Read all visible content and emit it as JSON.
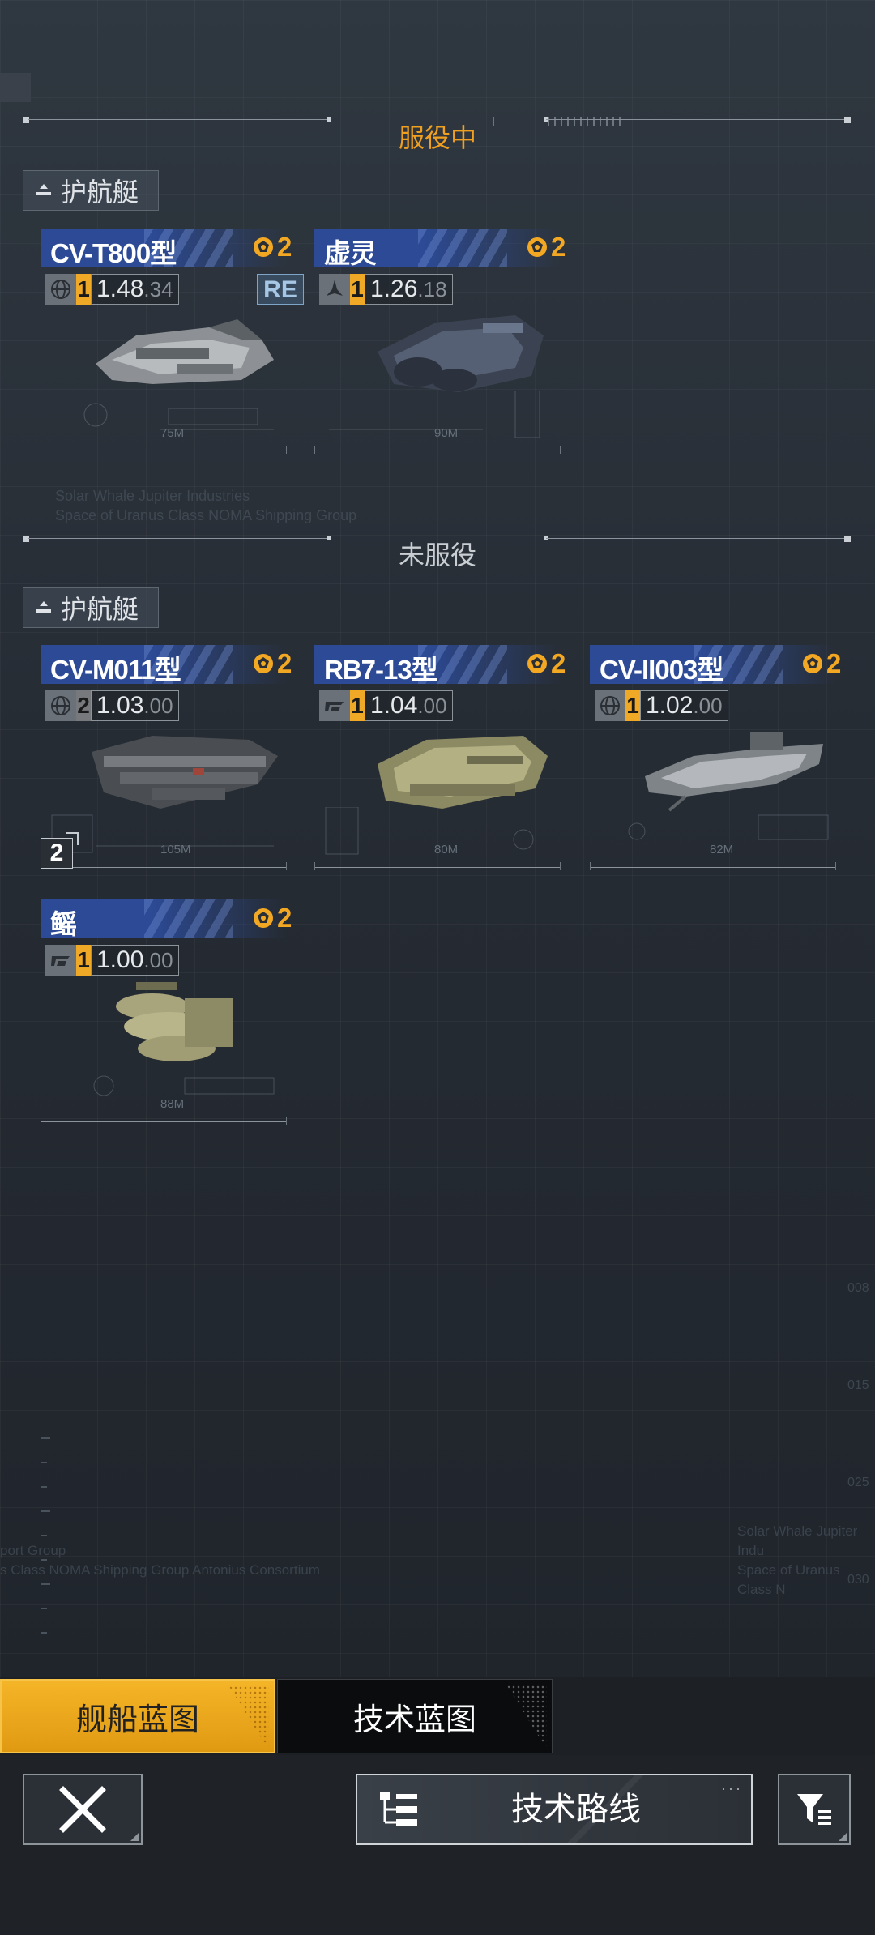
{
  "sections": {
    "in_service": {
      "title": "服役中",
      "color": "#f0a020"
    },
    "not_in_service": {
      "title": "未服役",
      "color": "#c9ced3"
    }
  },
  "categories": {
    "escort": "护航艇"
  },
  "in_service_ships": [
    {
      "name": "CV-T800型",
      "rank": "2",
      "stat_icon": "globe-icon",
      "level": "1",
      "value_main": "1.48",
      "value_sub": "34",
      "length": "75M",
      "badge": "RE"
    },
    {
      "name": "虚灵",
      "rank": "2",
      "stat_icon": "fighter-icon",
      "level": "1",
      "value_main": "1.26",
      "value_sub": "18",
      "length": "90M"
    }
  ],
  "not_in_service_ships": [
    {
      "name": "CV-M011型",
      "rank": "2",
      "stat_icon": "globe-icon",
      "level": "2",
      "value_main": "1.03",
      "value_sub": "00",
      "length": "105M",
      "count": "2"
    },
    {
      "name": "RB7-13型",
      "rank": "2",
      "stat_icon": "brand-icon",
      "level": "1",
      "value_main": "1.04",
      "value_sub": "00",
      "length": "80M"
    },
    {
      "name": "CV-II003型",
      "rank": "2",
      "stat_icon": "globe-icon",
      "level": "1",
      "value_main": "1.02",
      "value_sub": "00",
      "length": "82M"
    },
    {
      "name": "鳐",
      "rank": "2",
      "stat_icon": "brand-icon",
      "level": "1",
      "value_main": "1.00",
      "value_sub": "00",
      "length": "88M"
    }
  ],
  "watermarks": {
    "line1": "Solar Whale Jupiter Industries",
    "line2": "Space of Uranus Class NOMA Shipping Group",
    "bottom_left1": "port Group",
    "bottom_left2": "s Class NOMA Shipping Group Antonius Consortium",
    "bottom_right1": "Solar Whale Jupiter Indu",
    "bottom_right2": "Space of Uranus Class N",
    "side_nums": [
      "008",
      "015",
      "025",
      "030"
    ]
  },
  "tabs": {
    "ship_blueprint": "舰船蓝图",
    "tech_blueprint": "技术蓝图"
  },
  "actions": {
    "tech_route": "技术路线",
    "more": "···"
  },
  "colors": {
    "accent": "#f3a823",
    "name_bar": "#2c4a95"
  }
}
